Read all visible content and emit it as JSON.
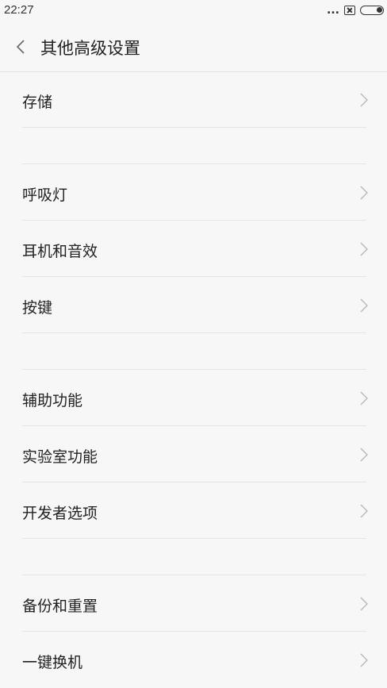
{
  "status_bar": {
    "time": "22:27",
    "icons": [
      "more-dots-icon",
      "notification-box-icon",
      "battery-icon"
    ],
    "dots": "..."
  },
  "header": {
    "back_icon": "chevron-left-icon",
    "title": "其他高级设置"
  },
  "groups": [
    {
      "items": [
        {
          "label": "存储",
          "icon": "chevron-right-icon"
        }
      ]
    },
    {
      "items": [
        {
          "label": "呼吸灯",
          "icon": "chevron-right-icon"
        },
        {
          "label": "耳机和音效",
          "icon": "chevron-right-icon"
        },
        {
          "label": "按键",
          "icon": "chevron-right-icon"
        }
      ]
    },
    {
      "items": [
        {
          "label": "辅助功能",
          "icon": "chevron-right-icon"
        },
        {
          "label": "实验室功能",
          "icon": "chevron-right-icon"
        },
        {
          "label": "开发者选项",
          "icon": "chevron-right-icon"
        }
      ]
    },
    {
      "items": [
        {
          "label": "备份和重置",
          "icon": "chevron-right-icon"
        },
        {
          "label": "一键换机",
          "icon": "chevron-right-icon"
        }
      ]
    }
  ],
  "colors": {
    "background": "#f7f7f7",
    "divider": "#e4e4e4",
    "text": "#222222",
    "chevron": "#b5b5b5"
  }
}
